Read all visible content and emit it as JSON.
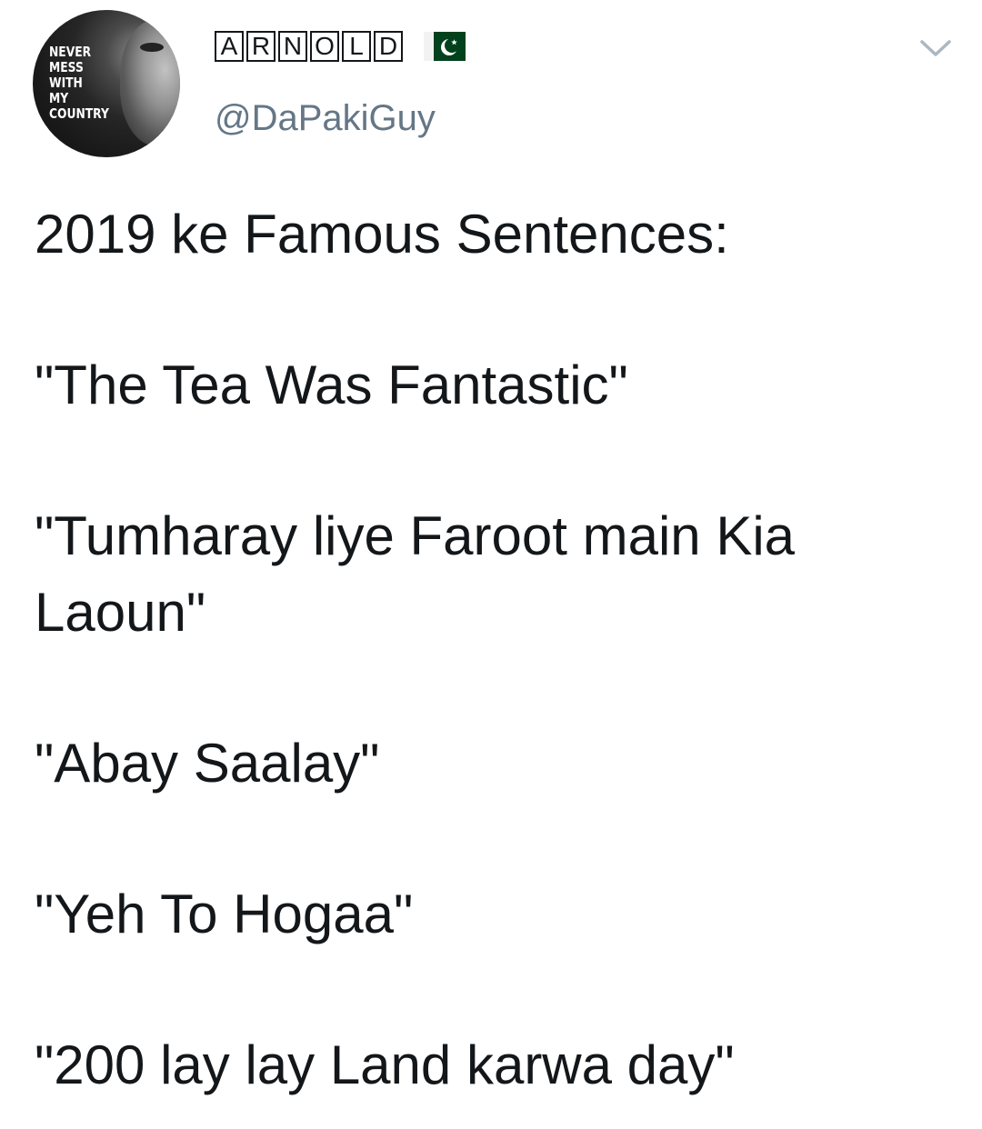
{
  "user": {
    "avatar_text": "NEVER\nMESS\nWITH\nMY\nCOUNTRY",
    "display_name_letters": [
      "A",
      "R",
      "N",
      "O",
      "L",
      "D"
    ],
    "flag_icon": "pakistan-flag-icon",
    "handle": "@DaPakiGuy"
  },
  "menu": {
    "icon": "chevron-down-icon"
  },
  "tweet": {
    "heading": "2019 ke Famous Sentences:",
    "quotes": [
      "\"The Tea Was Fantastic\"",
      "\"Tumharay liye Faroot main Kia Laoun\"",
      "\"Abay Saalay\"",
      "\"Yeh To Hogaa\"",
      "\"200 lay lay Land karwa day\""
    ]
  },
  "colors": {
    "text": "#14171a",
    "handle": "#657786",
    "flag_green": "#01411c",
    "chevron": "#aab8c2"
  }
}
